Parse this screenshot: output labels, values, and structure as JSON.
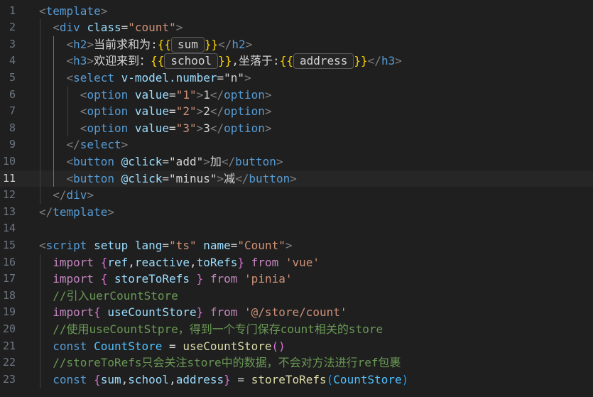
{
  "editor": {
    "current_line": 11,
    "lines": [
      {
        "n": "1",
        "tokens": [
          {
            "t": "<",
            "c": "pun"
          },
          {
            "t": "template",
            "c": "tag"
          },
          {
            "t": ">",
            "c": "pun"
          }
        ]
      },
      {
        "n": "2",
        "tokens": [
          {
            "t": "  "
          },
          {
            "t": "<",
            "c": "pun"
          },
          {
            "t": "div",
            "c": "tag"
          },
          {
            "t": " "
          },
          {
            "t": "class",
            "c": "attr"
          },
          {
            "t": "=",
            "c": "txt"
          },
          {
            "t": "\"count\"",
            "c": "str"
          },
          {
            "t": ">",
            "c": "pun"
          }
        ]
      },
      {
        "n": "3",
        "tokens": [
          {
            "t": "    "
          },
          {
            "t": "<",
            "c": "pun"
          },
          {
            "t": "h2",
            "c": "tag"
          },
          {
            "t": ">",
            "c": "pun"
          },
          {
            "t": "当前求和为:",
            "c": "txt"
          },
          {
            "t": "{{",
            "c": "brace"
          },
          {
            "t": "sum",
            "c": "var",
            "hint": true
          },
          {
            "t": "}}",
            "c": "brace"
          },
          {
            "t": "</",
            "c": "pun"
          },
          {
            "t": "h2",
            "c": "tag"
          },
          {
            "t": ">",
            "c": "pun"
          }
        ]
      },
      {
        "n": "4",
        "tokens": [
          {
            "t": "    "
          },
          {
            "t": "<",
            "c": "pun"
          },
          {
            "t": "h3",
            "c": "tag"
          },
          {
            "t": ">",
            "c": "pun"
          },
          {
            "t": "欢迎来到：",
            "c": "txt"
          },
          {
            "t": "{{",
            "c": "brace"
          },
          {
            "t": "school",
            "c": "var",
            "hint": true
          },
          {
            "t": "}}",
            "c": "brace"
          },
          {
            "t": ",坐落于:",
            "c": "txt"
          },
          {
            "t": "{{",
            "c": "brace"
          },
          {
            "t": "address",
            "c": "var",
            "hint": true
          },
          {
            "t": "}}",
            "c": "brace"
          },
          {
            "t": "</",
            "c": "pun"
          },
          {
            "t": "h3",
            "c": "tag"
          },
          {
            "t": ">",
            "c": "pun"
          }
        ]
      },
      {
        "n": "5",
        "tokens": [
          {
            "t": "    "
          },
          {
            "t": "<",
            "c": "pun"
          },
          {
            "t": "select",
            "c": "tag"
          },
          {
            "t": " "
          },
          {
            "t": "v-model.number",
            "c": "attr"
          },
          {
            "t": "=",
            "c": "txt"
          },
          {
            "t": "\"n\"",
            "c": "txt"
          },
          {
            "t": ">",
            "c": "pun"
          }
        ]
      },
      {
        "n": "6",
        "tokens": [
          {
            "t": "      "
          },
          {
            "t": "<",
            "c": "pun"
          },
          {
            "t": "option",
            "c": "tag"
          },
          {
            "t": " "
          },
          {
            "t": "value",
            "c": "attr"
          },
          {
            "t": "=",
            "c": "txt"
          },
          {
            "t": "\"1\"",
            "c": "str"
          },
          {
            "t": ">",
            "c": "pun"
          },
          {
            "t": "1",
            "c": "txt"
          },
          {
            "t": "</",
            "c": "pun"
          },
          {
            "t": "option",
            "c": "tag"
          },
          {
            "t": ">",
            "c": "pun"
          }
        ]
      },
      {
        "n": "7",
        "tokens": [
          {
            "t": "      "
          },
          {
            "t": "<",
            "c": "pun"
          },
          {
            "t": "option",
            "c": "tag"
          },
          {
            "t": " "
          },
          {
            "t": "value",
            "c": "attr"
          },
          {
            "t": "=",
            "c": "txt"
          },
          {
            "t": "\"2\"",
            "c": "str"
          },
          {
            "t": ">",
            "c": "pun"
          },
          {
            "t": "2",
            "c": "txt"
          },
          {
            "t": "</",
            "c": "pun"
          },
          {
            "t": "option",
            "c": "tag"
          },
          {
            "t": ">",
            "c": "pun"
          }
        ]
      },
      {
        "n": "8",
        "tokens": [
          {
            "t": "      "
          },
          {
            "t": "<",
            "c": "pun"
          },
          {
            "t": "option",
            "c": "tag"
          },
          {
            "t": " "
          },
          {
            "t": "value",
            "c": "attr"
          },
          {
            "t": "=",
            "c": "txt"
          },
          {
            "t": "\"3\"",
            "c": "str"
          },
          {
            "t": ">",
            "c": "pun"
          },
          {
            "t": "3",
            "c": "txt"
          },
          {
            "t": "</",
            "c": "pun"
          },
          {
            "t": "option",
            "c": "tag"
          },
          {
            "t": ">",
            "c": "pun"
          }
        ]
      },
      {
        "n": "9",
        "tokens": [
          {
            "t": "    "
          },
          {
            "t": "</",
            "c": "pun"
          },
          {
            "t": "select",
            "c": "tag"
          },
          {
            "t": ">",
            "c": "pun"
          }
        ]
      },
      {
        "n": "10",
        "tokens": [
          {
            "t": "    "
          },
          {
            "t": "<",
            "c": "pun"
          },
          {
            "t": "button",
            "c": "tag"
          },
          {
            "t": " "
          },
          {
            "t": "@click",
            "c": "attr"
          },
          {
            "t": "=",
            "c": "txt"
          },
          {
            "t": "\"add\"",
            "c": "txt"
          },
          {
            "t": ">",
            "c": "pun"
          },
          {
            "t": "加",
            "c": "txt"
          },
          {
            "t": "</",
            "c": "pun"
          },
          {
            "t": "button",
            "c": "tag"
          },
          {
            "t": ">",
            "c": "pun"
          }
        ]
      },
      {
        "n": "11",
        "tokens": [
          {
            "t": "    "
          },
          {
            "t": "<",
            "c": "pun"
          },
          {
            "t": "button",
            "c": "tag"
          },
          {
            "t": " "
          },
          {
            "t": "@click",
            "c": "attr"
          },
          {
            "t": "=",
            "c": "txt"
          },
          {
            "t": "\"minus\"",
            "c": "txt"
          },
          {
            "t": ">",
            "c": "pun"
          },
          {
            "t": "减",
            "c": "txt"
          },
          {
            "t": "</",
            "c": "pun"
          },
          {
            "t": "button",
            "c": "tag"
          },
          {
            "t": ">",
            "c": "pun"
          }
        ]
      },
      {
        "n": "12",
        "tokens": [
          {
            "t": "  "
          },
          {
            "t": "</",
            "c": "pun"
          },
          {
            "t": "div",
            "c": "tag"
          },
          {
            "t": ">",
            "c": "pun"
          }
        ]
      },
      {
        "n": "13",
        "tokens": [
          {
            "t": "</",
            "c": "pun"
          },
          {
            "t": "template",
            "c": "tag"
          },
          {
            "t": ">",
            "c": "pun"
          }
        ]
      },
      {
        "n": "14",
        "tokens": []
      },
      {
        "n": "15",
        "tokens": [
          {
            "t": "<",
            "c": "pun"
          },
          {
            "t": "script",
            "c": "tag"
          },
          {
            "t": " "
          },
          {
            "t": "setup",
            "c": "attr"
          },
          {
            "t": " "
          },
          {
            "t": "lang",
            "c": "attr"
          },
          {
            "t": "=",
            "c": "txt"
          },
          {
            "t": "\"ts\"",
            "c": "str"
          },
          {
            "t": " "
          },
          {
            "t": "name",
            "c": "attr"
          },
          {
            "t": "=",
            "c": "txt"
          },
          {
            "t": "\"Count\"",
            "c": "str"
          },
          {
            "t": ">",
            "c": "pun"
          }
        ]
      },
      {
        "n": "16",
        "tokens": [
          {
            "t": "  "
          },
          {
            "t": "import",
            "c": "ctl"
          },
          {
            "t": " "
          },
          {
            "t": "{",
            "c": "brk"
          },
          {
            "t": "ref",
            "c": "var"
          },
          {
            "t": ",",
            "c": "txt"
          },
          {
            "t": "reactive",
            "c": "var"
          },
          {
            "t": ",",
            "c": "txt"
          },
          {
            "t": "toRefs",
            "c": "var"
          },
          {
            "t": "}",
            "c": "brk"
          },
          {
            "t": " "
          },
          {
            "t": "from",
            "c": "ctl"
          },
          {
            "t": " "
          },
          {
            "t": "'vue'",
            "c": "str"
          }
        ]
      },
      {
        "n": "17",
        "tokens": [
          {
            "t": "  "
          },
          {
            "t": "import",
            "c": "ctl"
          },
          {
            "t": " "
          },
          {
            "t": "{",
            "c": "brk"
          },
          {
            "t": " "
          },
          {
            "t": "storeToRefs",
            "c": "var"
          },
          {
            "t": " "
          },
          {
            "t": "}",
            "c": "brk"
          },
          {
            "t": " "
          },
          {
            "t": "from",
            "c": "ctl"
          },
          {
            "t": " "
          },
          {
            "t": "'pinia'",
            "c": "str"
          }
        ]
      },
      {
        "n": "18",
        "tokens": [
          {
            "t": "  "
          },
          {
            "t": "//引入uerCountStore",
            "c": "cmt"
          }
        ]
      },
      {
        "n": "19",
        "tokens": [
          {
            "t": "  "
          },
          {
            "t": "import",
            "c": "ctl"
          },
          {
            "t": "{",
            "c": "brk"
          },
          {
            "t": " "
          },
          {
            "t": "useCountStore",
            "c": "var"
          },
          {
            "t": "}",
            "c": "brk"
          },
          {
            "t": " "
          },
          {
            "t": "from",
            "c": "ctl"
          },
          {
            "t": " "
          },
          {
            "t": "'@/store/count'",
            "c": "str"
          }
        ]
      },
      {
        "n": "20",
        "tokens": [
          {
            "t": "  "
          },
          {
            "t": "//使用useCountStpre，得到一个专门保存count相关的store",
            "c": "cmt"
          }
        ]
      },
      {
        "n": "21",
        "tokens": [
          {
            "t": "  "
          },
          {
            "t": "const",
            "c": "kw"
          },
          {
            "t": " "
          },
          {
            "t": "CountStore",
            "c": "cls"
          },
          {
            "t": " = ",
            "c": "txt"
          },
          {
            "t": "useCountStore",
            "c": "fn"
          },
          {
            "t": "()",
            "c": "brk"
          }
        ]
      },
      {
        "n": "22",
        "tokens": [
          {
            "t": "  "
          },
          {
            "t": "//storeToRefs只会关注store中的数据，不会对方法进行ref包裹",
            "c": "cmt"
          }
        ]
      },
      {
        "n": "23",
        "tokens": [
          {
            "t": "  "
          },
          {
            "t": "const",
            "c": "kw"
          },
          {
            "t": " "
          },
          {
            "t": "{",
            "c": "brk"
          },
          {
            "t": "sum",
            "c": "var"
          },
          {
            "t": ",",
            "c": "txt"
          },
          {
            "t": "school",
            "c": "var"
          },
          {
            "t": ",",
            "c": "txt"
          },
          {
            "t": "address",
            "c": "var"
          },
          {
            "t": "}",
            "c": "brk"
          },
          {
            "t": " = ",
            "c": "txt"
          },
          {
            "t": "storeToRefs",
            "c": "fn"
          },
          {
            "t": "(",
            "c": "brk2"
          },
          {
            "t": "CountStore",
            "c": "cls"
          },
          {
            "t": ")",
            "c": "brk2"
          }
        ]
      }
    ]
  },
  "colors": {
    "background": "#1f1f1f",
    "current_line": "#262626",
    "line_number": "#6e7681",
    "tag": "#569cd6",
    "attribute": "#9cdcfe",
    "string": "#ce9178",
    "comment": "#6a9955",
    "keyword_control": "#c586c0"
  }
}
